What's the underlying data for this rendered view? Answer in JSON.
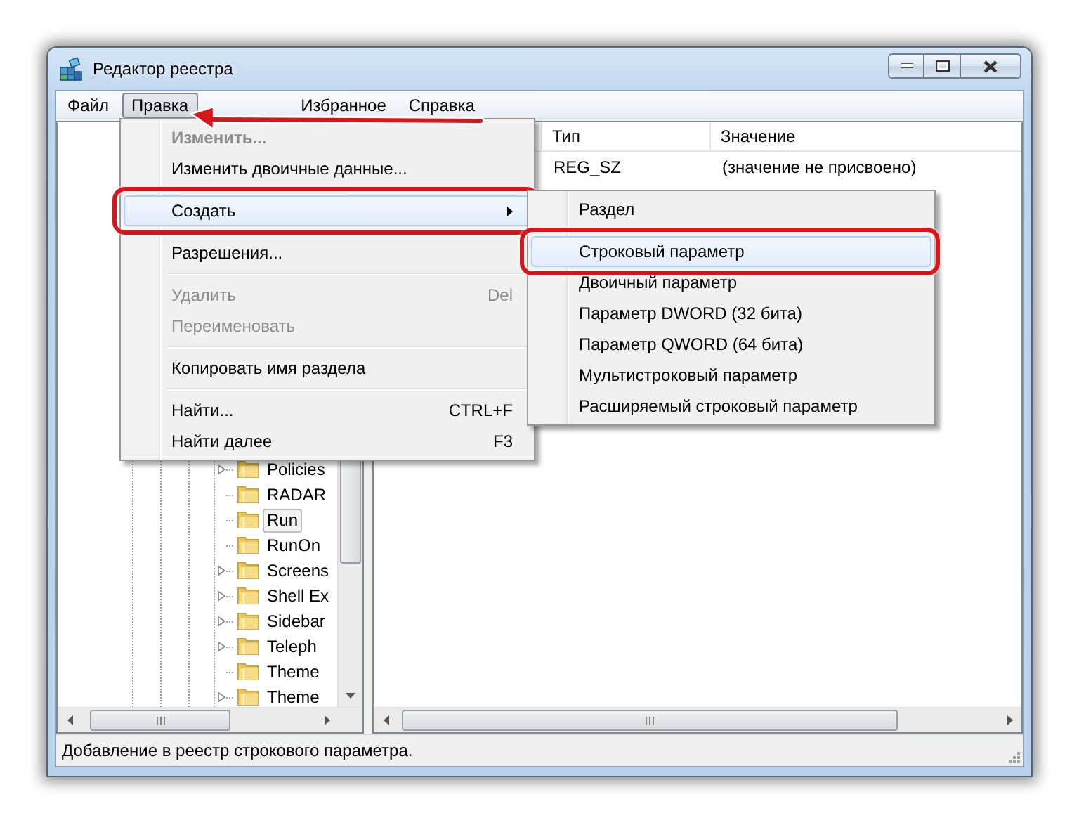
{
  "window": {
    "title": "Редактор реестра"
  },
  "menu_bar": [
    {
      "label": "Файл",
      "selected": false
    },
    {
      "label": "Правка",
      "selected": true
    },
    {
      "label": "Избранное",
      "selected": false
    },
    {
      "label": "Справка",
      "selected": false
    }
  ],
  "tree": {
    "items": [
      {
        "label": "Policies",
        "expandable": true,
        "selected": false
      },
      {
        "label": "RADAR",
        "expandable": false,
        "selected": false
      },
      {
        "label": "Run",
        "expandable": false,
        "selected": true
      },
      {
        "label": "RunOn",
        "expandable": false,
        "selected": false
      },
      {
        "label": "Screens",
        "expandable": true,
        "selected": false
      },
      {
        "label": "Shell Ex",
        "expandable": true,
        "selected": false
      },
      {
        "label": "Sidebar",
        "expandable": true,
        "selected": false
      },
      {
        "label": "Teleph",
        "expandable": true,
        "selected": false
      },
      {
        "label": "Theme",
        "expandable": false,
        "selected": false
      },
      {
        "label": "Theme",
        "expandable": true,
        "selected": false
      }
    ]
  },
  "list": {
    "columns": [
      "Тип",
      "Значение"
    ],
    "rows": [
      {
        "type": "REG_SZ",
        "value": "(значение не присвоено)"
      }
    ]
  },
  "edit_menu": {
    "items": [
      {
        "kind": "item",
        "label": "Изменить...",
        "default": true,
        "disabled": true,
        "highlighted": false,
        "submenu": false,
        "circled": false
      },
      {
        "kind": "item",
        "label": "Изменить двоичные данные...",
        "default": false,
        "disabled": false,
        "highlighted": false,
        "submenu": false,
        "circled": false
      },
      {
        "kind": "separator"
      },
      {
        "kind": "item",
        "label": "Создать",
        "default": false,
        "disabled": false,
        "highlighted": true,
        "submenu": true,
        "circled": true
      },
      {
        "kind": "separator"
      },
      {
        "kind": "item",
        "label": "Разрешения...",
        "default": false,
        "disabled": false,
        "highlighted": false,
        "submenu": false,
        "circled": false
      },
      {
        "kind": "separator"
      },
      {
        "kind": "item",
        "label": "Удалить",
        "shortcut": "Del",
        "default": false,
        "disabled": true,
        "highlighted": false,
        "submenu": false,
        "circled": false
      },
      {
        "kind": "item",
        "label": "Переименовать",
        "default": false,
        "disabled": true,
        "highlighted": false,
        "submenu": false,
        "circled": false
      },
      {
        "kind": "separator"
      },
      {
        "kind": "item",
        "label": "Копировать имя раздела",
        "default": false,
        "disabled": false,
        "highlighted": false,
        "submenu": false,
        "circled": false
      },
      {
        "kind": "separator"
      },
      {
        "kind": "item",
        "label": "Найти...",
        "shortcut": "CTRL+F",
        "default": false,
        "disabled": false,
        "highlighted": false,
        "submenu": false,
        "circled": false
      },
      {
        "kind": "item",
        "label": "Найти далее",
        "shortcut": "F3",
        "default": false,
        "disabled": false,
        "highlighted": false,
        "submenu": false,
        "circled": false
      }
    ]
  },
  "create_submenu": {
    "items": [
      {
        "kind": "item",
        "label": "Раздел",
        "default": false,
        "disabled": false,
        "highlighted": false,
        "submenu": false,
        "circled": false
      },
      {
        "kind": "separator"
      },
      {
        "kind": "item",
        "label": "Строковый параметр",
        "default": false,
        "disabled": false,
        "highlighted": true,
        "submenu": false,
        "circled": true
      },
      {
        "kind": "item",
        "label": "Двоичный параметр",
        "default": false,
        "disabled": false,
        "highlighted": false,
        "submenu": false,
        "circled": false
      },
      {
        "kind": "item",
        "label": "Параметр DWORD (32 бита)",
        "default": false,
        "disabled": false,
        "highlighted": false,
        "submenu": false,
        "circled": false
      },
      {
        "kind": "item",
        "label": "Параметр QWORD (64 бита)",
        "default": false,
        "disabled": false,
        "highlighted": false,
        "submenu": false,
        "circled": false
      },
      {
        "kind": "item",
        "label": "Мультистроковый параметр",
        "default": false,
        "disabled": false,
        "highlighted": false,
        "submenu": false,
        "circled": false
      },
      {
        "kind": "item",
        "label": "Расширяемый строковый параметр",
        "default": false,
        "disabled": false,
        "highlighted": false,
        "submenu": false,
        "circled": false
      }
    ]
  },
  "status_bar": {
    "text": "Добавление в реестр строкового параметра."
  }
}
